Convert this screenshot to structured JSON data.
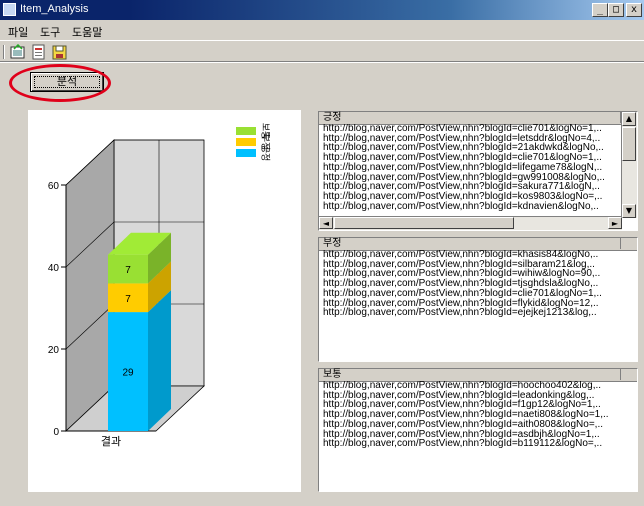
{
  "window": {
    "title": "Item_Analysis",
    "minimize": "_",
    "maximize": "□",
    "close": "x"
  },
  "menu": [
    "파일",
    "도구",
    "도움말"
  ],
  "toolbar": {
    "icons": [
      "open-icon",
      "save-icon",
      "export-icon"
    ]
  },
  "analyze_button": "분석",
  "chart_data": {
    "type": "bar",
    "stacked": true,
    "three_d": true,
    "categories": [
      "결과"
    ],
    "series": [
      {
        "name": "긍정",
        "values": [
          29
        ],
        "color": "#00c0ff"
      },
      {
        "name": "부정",
        "values": [
          7
        ],
        "color": "#ffcc00"
      },
      {
        "name": "보통",
        "values": [
          7
        ],
        "color": "#99e033"
      }
    ],
    "legend_order": [
      "보통",
      "부정",
      "긍정"
    ],
    "ylim": [
      0,
      60
    ],
    "yticks": [
      0,
      20,
      40,
      60
    ],
    "legend_position": "top-right"
  },
  "lists": {
    "positive": {
      "header": "긍정",
      "items": [
        "http://blog,naver,com/PostView,nhn?blogId=clie701&logNo=1,..",
        "http://blog,naver,com/PostView,nhn?blogId=letsddr&logNo=4,..",
        "http://blog,naver,com/PostView,nhn?blogId=21akdwkd&logNo,..",
        "http://blog,naver,com/PostView,nhn?blogId=clie701&logNo=1,..",
        "http://blog,naver,com/PostView,nhn?blogId=lifegame78&logN,..",
        "http://blog,naver,com/PostView,nhn?blogId=gw991008&logNo,..",
        "http://blog,naver,com/PostView,nhn?blogId=sakura771&logN,..",
        "http://blog,naver,com/PostView,nhn?blogId=kos9803&logNo=,..",
        "http://blog,naver,com/PostView,nhn?blogId=kdnavien&logNo,.."
      ]
    },
    "negative": {
      "header": "부정",
      "items": [
        "http://blog,naver,com/PostView,nhn?blogId=khasis84&logNo,..",
        "http://blog,naver,com/PostView,nhn?blogId=silbaram21&log,..",
        "http://blog,naver,com/PostView,nhn?blogId=wihiw&logNo=90,..",
        "http://blog,naver,com/PostView,nhn?blogId=tjsghdsla&logNo,..",
        "http://blog,naver,com/PostView,nhn?blogId=clie701&logNo=1,..",
        "http://blog,naver,com/PostView,nhn?blogId=flykid&logNo=12,..",
        "http://blog,naver,com/PostView,nhn?blogId=ejejkej1213&log,.."
      ]
    },
    "neutral": {
      "header": "보통",
      "items": [
        "http://blog,naver,com/PostView,nhn?blogId=hoochoo402&log,..",
        "http://blog,naver,com/PostView,nhn?blogId=leadonking&log,..",
        "http://blog,naver,com/PostView,nhn?blogId=f1gp12&logNo=1,..",
        "http://blog,naver,com/PostView,nhn?blogId=naeti808&logNo=1,..",
        "http://blog,naver,com/PostView,nhn?blogId=aith0808&logNo=,..",
        "http://blog,naver,com/PostView,nhn?blogId=asdbjh&logNo=1,..",
        "http://blog,naver,com/PostView,nhn?blogId=b119112&logNo=,.."
      ]
    }
  }
}
